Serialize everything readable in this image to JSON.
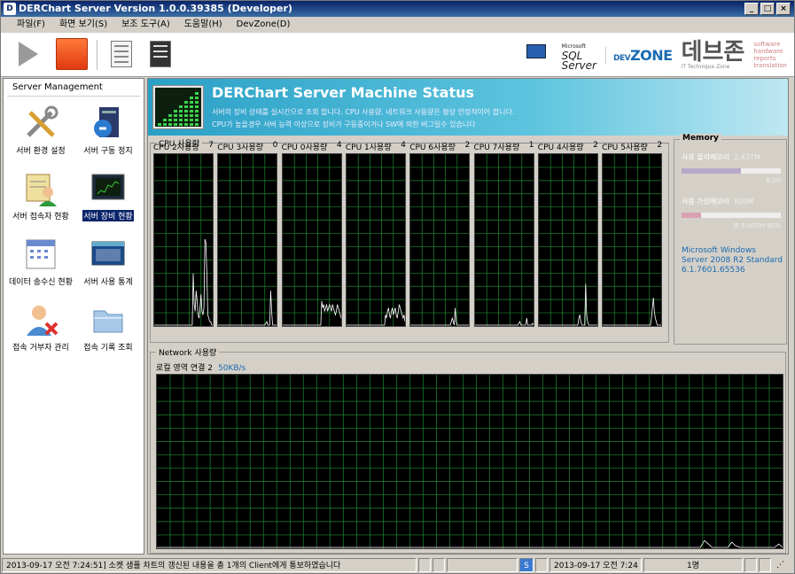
{
  "window": {
    "title": "DERChart Server Version 1.0.0.39385 (Developer)",
    "icon": "app-icon"
  },
  "menu": [
    {
      "label": "파일(F)"
    },
    {
      "label": "화면 보기(S)"
    },
    {
      "label": "보조 도구(A)"
    },
    {
      "label": "도움말(H)"
    },
    {
      "label": "DevZone(D)"
    }
  ],
  "toolbar": {
    "sql_line1": "SQL",
    "sql_line2": "Server",
    "sql_small": "Microsoft",
    "devzone_prefix": "DEV",
    "devzone_name": "ZONE",
    "debzone": "데브존",
    "debzone_sub": "IT Technique Zone",
    "tags": [
      "software",
      "hardware",
      "reports",
      "translation"
    ]
  },
  "sidebar": {
    "header": "Server Management",
    "items": [
      {
        "label": "서버 환경 설정",
        "icon": "tools-icon"
      },
      {
        "label": "서버 구동 정지",
        "icon": "server-stop-icon"
      },
      {
        "label": "서버 접속자 현황",
        "icon": "user-list-icon"
      },
      {
        "label": "서버 장비 현황",
        "icon": "monitor-chart-icon"
      },
      {
        "label": "데이터 송수신 현황",
        "icon": "calendar-icon"
      },
      {
        "label": "서버 사용 통계",
        "icon": "window-stats-icon"
      },
      {
        "label": "접속 거부자 관리",
        "icon": "user-block-icon"
      },
      {
        "label": "접속 기록 조회",
        "icon": "log-folder-icon"
      }
    ]
  },
  "banner": {
    "title": "DERChart Server Machine Status",
    "line1": "서버의 장비 상태를 실시간으로 조회 합니다. CPU 사용량, 네트워크 사용량은 평상 안정적이어 합니다.",
    "line2": "CPU가 높을경우 서버 능력 이상으로 장비가 구동중이거나 SW에 의한 버그일수 있습니다"
  },
  "cpu": {
    "group_title": "CPU 사용량",
    "cores": [
      {
        "label": "CPU 2사용량",
        "value": "7",
        "samples": [
          0,
          0,
          0,
          0,
          0,
          0,
          0,
          0,
          0,
          0,
          0,
          0,
          0,
          0,
          0,
          0,
          0,
          0,
          0,
          0,
          0,
          0,
          0,
          0,
          0,
          0,
          0,
          0,
          0,
          0,
          0,
          0,
          0,
          0,
          0,
          0,
          0,
          0,
          0,
          0,
          30,
          12,
          8,
          20,
          14,
          6,
          4,
          10,
          18,
          8,
          6,
          10,
          50,
          48,
          30,
          6,
          4,
          2,
          2,
          0,
          0
        ]
      },
      {
        "label": "CPU 3사용량",
        "value": "0",
        "samples": [
          0,
          0,
          0,
          0,
          0,
          0,
          0,
          0,
          0,
          0,
          0,
          0,
          0,
          0,
          0,
          0,
          0,
          0,
          0,
          0,
          0,
          0,
          0,
          0,
          0,
          0,
          0,
          0,
          0,
          0,
          0,
          0,
          0,
          0,
          0,
          0,
          0,
          0,
          0,
          0,
          0,
          0,
          0,
          0,
          0,
          0,
          0,
          0,
          0,
          1,
          2,
          0,
          0,
          0,
          20,
          8,
          0,
          0,
          0,
          0,
          0
        ]
      },
      {
        "label": "CPU 0사용량",
        "value": "4",
        "samples": [
          0,
          0,
          0,
          0,
          0,
          0,
          0,
          0,
          0,
          0,
          0,
          0,
          0,
          0,
          0,
          0,
          0,
          0,
          0,
          0,
          0,
          0,
          0,
          0,
          0,
          0,
          0,
          0,
          0,
          0,
          0,
          0,
          0,
          0,
          0,
          0,
          0,
          0,
          0,
          0,
          14,
          10,
          12,
          8,
          10,
          12,
          8,
          10,
          12,
          10,
          8,
          12,
          10,
          8,
          6,
          8,
          12,
          10,
          8,
          6,
          4
        ]
      },
      {
        "label": "CPU 1사용량",
        "value": "4",
        "samples": [
          0,
          0,
          0,
          0,
          0,
          0,
          0,
          0,
          0,
          0,
          0,
          0,
          0,
          0,
          0,
          0,
          0,
          0,
          0,
          0,
          0,
          0,
          0,
          0,
          0,
          0,
          0,
          0,
          0,
          0,
          0,
          0,
          0,
          0,
          0,
          0,
          0,
          0,
          0,
          0,
          6,
          4,
          8,
          10,
          6,
          4,
          8,
          10,
          6,
          8,
          10,
          6,
          4,
          8,
          12,
          10,
          8,
          6,
          4,
          6,
          2
        ]
      },
      {
        "label": "CPU 6사용량",
        "value": "2",
        "samples": [
          0,
          0,
          0,
          0,
          0,
          0,
          0,
          0,
          0,
          0,
          0,
          0,
          0,
          0,
          0,
          0,
          0,
          0,
          0,
          0,
          0,
          0,
          0,
          0,
          0,
          0,
          0,
          0,
          0,
          0,
          0,
          0,
          0,
          0,
          0,
          0,
          0,
          0,
          0,
          0,
          0,
          0,
          2,
          4,
          2,
          0,
          10,
          2,
          0,
          0,
          0,
          0,
          0,
          0,
          0,
          0,
          0,
          0,
          0,
          0,
          0
        ]
      },
      {
        "label": "CPU 7사용량",
        "value": "1",
        "samples": [
          0,
          0,
          0,
          0,
          0,
          0,
          0,
          0,
          0,
          0,
          0,
          0,
          0,
          0,
          0,
          0,
          0,
          0,
          0,
          0,
          0,
          0,
          0,
          0,
          0,
          0,
          0,
          0,
          0,
          0,
          0,
          0,
          0,
          0,
          0,
          0,
          0,
          0,
          0,
          0,
          0,
          0,
          0,
          0,
          0,
          1,
          2,
          0,
          0,
          0,
          0,
          0,
          0,
          4,
          0,
          0,
          0,
          0,
          0,
          1,
          0
        ]
      },
      {
        "label": "CPU 4사용량",
        "value": "2",
        "samples": [
          0,
          0,
          0,
          0,
          0,
          0,
          0,
          0,
          0,
          0,
          0,
          0,
          0,
          0,
          0,
          0,
          0,
          0,
          0,
          0,
          0,
          0,
          0,
          0,
          0,
          0,
          0,
          0,
          0,
          0,
          0,
          0,
          0,
          0,
          0,
          0,
          0,
          0,
          0,
          0,
          0,
          4,
          6,
          2,
          0,
          0,
          0,
          0,
          24,
          6,
          2,
          0,
          0,
          0,
          0,
          0,
          0,
          0,
          0,
          0,
          0
        ]
      },
      {
        "label": "CPU 5사용량",
        "value": "2",
        "samples": [
          0,
          0,
          0,
          0,
          0,
          0,
          0,
          0,
          0,
          0,
          0,
          0,
          0,
          0,
          0,
          0,
          0,
          0,
          0,
          0,
          0,
          0,
          0,
          0,
          0,
          0,
          0,
          0,
          0,
          0,
          0,
          0,
          0,
          0,
          0,
          0,
          0,
          0,
          0,
          0,
          0,
          0,
          0,
          0,
          0,
          0,
          0,
          0,
          0,
          0,
          4,
          10,
          16,
          8,
          4,
          2,
          0,
          0,
          0,
          0,
          0
        ]
      }
    ]
  },
  "memory": {
    "title": "Memory",
    "physical_label": "사용 물리메모리",
    "physical_value": "2.43TM",
    "physical_fraction": 0.6,
    "physical_foot": "8.0G",
    "virtual_label": "사용 가상메모리",
    "virtual_value": "800M",
    "virtual_fraction": 0.2,
    "virtual_foot": "총 8.00GM   80%",
    "os_line1": "Microsoft Windows",
    "os_line2": "Server 2008 R2 Standard",
    "os_line3": "6.1.7601.65536",
    "physical_color": "#b8a8c8",
    "virtual_color": "#d8a0b0"
  },
  "network": {
    "group_title": "Network 사용량",
    "adapter": "로컬 영역 연결 2",
    "rate": "50KB/s",
    "samples": [
      0,
      0,
      0,
      0,
      0,
      0,
      0,
      0,
      0,
      0,
      0,
      0,
      0,
      0,
      0,
      0,
      0,
      0,
      0,
      0,
      0,
      0,
      0,
      0,
      0,
      0,
      0,
      0,
      0,
      0,
      0,
      0,
      0,
      0,
      0,
      0,
      0,
      0,
      0,
      0,
      0,
      0,
      0,
      0,
      0,
      0,
      0,
      0,
      0,
      0,
      0,
      0,
      0,
      0,
      0,
      0,
      0,
      0,
      0,
      0,
      0,
      0,
      0,
      0,
      0,
      0,
      0,
      0,
      0,
      0,
      0,
      0,
      0,
      0,
      0,
      0,
      0,
      0,
      0,
      0,
      0,
      0,
      0,
      0,
      0,
      0,
      0,
      0,
      0,
      0,
      0,
      0,
      0,
      0,
      0,
      0,
      0,
      0,
      0,
      0,
      0,
      0,
      0,
      0,
      0,
      0,
      0,
      0,
      0,
      0,
      0,
      0,
      0,
      0,
      0,
      0,
      0,
      0,
      0,
      0,
      0,
      0,
      0,
      0,
      0,
      0,
      0,
      0,
      0,
      0,
      0,
      0,
      0,
      0,
      0,
      0,
      0,
      0,
      0,
      0,
      4,
      2,
      0,
      0,
      0,
      0,
      0,
      3,
      1,
      0,
      0,
      0,
      0,
      0,
      0,
      0,
      0,
      0,
      0,
      2,
      0
    ]
  },
  "status": {
    "message": "2013-09-17 오전 7:24:51] 소켓 샘플 차트의 갱신된 내용을 총 1개의 Client에게 통보하였습니다",
    "badge": "S",
    "datetime": "2013-09-17 오전 7:24",
    "users": "1명"
  },
  "colors": {
    "graph_bg": "#000000",
    "grid": "#1e8a2e",
    "line": "#ffffff"
  }
}
